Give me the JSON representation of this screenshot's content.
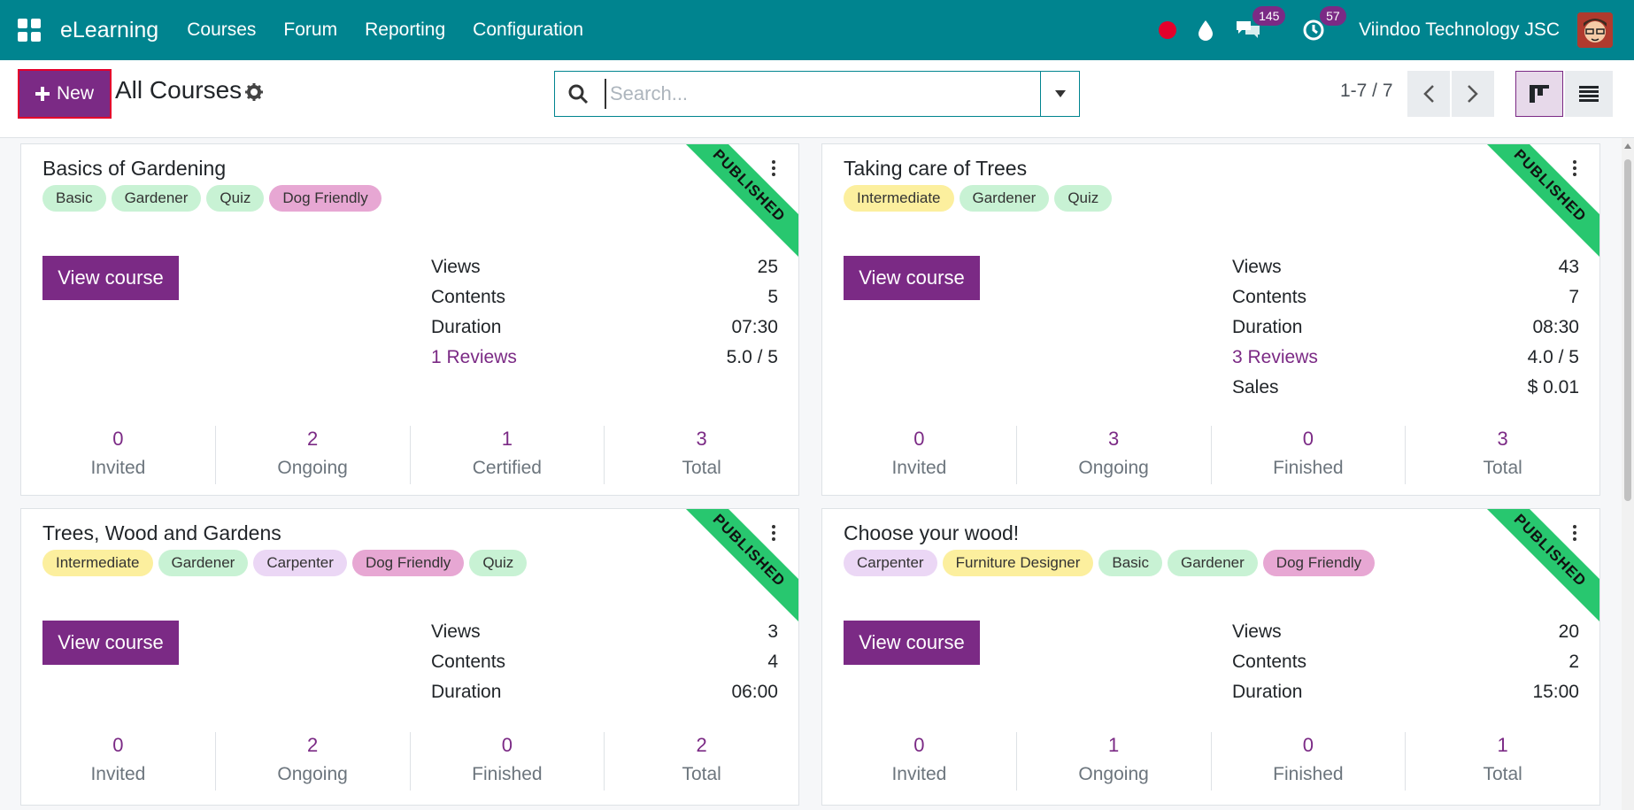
{
  "navbar": {
    "brand": "eLearning",
    "menu": [
      "Courses",
      "Forum",
      "Reporting",
      "Configuration"
    ],
    "messages_count": "145",
    "activities_count": "57",
    "company": "Viindoo Technology JSC"
  },
  "control_panel": {
    "new_label": "New",
    "title": "All Courses",
    "search_placeholder": "Search...",
    "pager": "1-7 / 7"
  },
  "colors": {
    "navbar": "#00848f",
    "primary": "#7b2a85",
    "ribbon": "#28c76f",
    "tag_green": "#c8f2d4",
    "tag_yellow": "#fcef9e",
    "tag_pink": "#e7a7d3",
    "tag_lavender": "#ebd7f5"
  },
  "cards": [
    {
      "title": "Basics of Gardening",
      "ribbon": "PUBLISHED",
      "tags": [
        "Basic",
        "Gardener",
        "Quiz",
        "Dog Friendly"
      ],
      "button": "View course",
      "stats": [
        {
          "label": "Views",
          "value": "25"
        },
        {
          "label": "Contents",
          "value": "5"
        },
        {
          "label": "Duration",
          "value": "07:30"
        },
        {
          "label": "1 Reviews",
          "value": "5.0 / 5"
        }
      ],
      "bottom": [
        {
          "num": "0",
          "label": "Invited"
        },
        {
          "num": "2",
          "label": "Ongoing"
        },
        {
          "num": "1",
          "label": "Certified"
        },
        {
          "num": "3",
          "label": "Total"
        }
      ]
    },
    {
      "title": "Taking care of Trees",
      "ribbon": "PUBLISHED",
      "tags": [
        "Intermediate",
        "Gardener",
        "Quiz"
      ],
      "button": "View course",
      "stats": [
        {
          "label": "Views",
          "value": "43"
        },
        {
          "label": "Contents",
          "value": "7"
        },
        {
          "label": "Duration",
          "value": "08:30"
        },
        {
          "label": "3 Reviews",
          "value": "4.0 / 5"
        },
        {
          "label": "Sales",
          "value": "$ 0.01"
        }
      ],
      "bottom": [
        {
          "num": "0",
          "label": "Invited"
        },
        {
          "num": "3",
          "label": "Ongoing"
        },
        {
          "num": "0",
          "label": "Finished"
        },
        {
          "num": "3",
          "label": "Total"
        }
      ]
    },
    {
      "title": "Trees, Wood and Gardens",
      "ribbon": "PUBLISHED",
      "tags": [
        "Intermediate",
        "Gardener",
        "Carpenter",
        "Dog Friendly",
        "Quiz"
      ],
      "button": "View course",
      "stats": [
        {
          "label": "Views",
          "value": "3"
        },
        {
          "label": "Contents",
          "value": "4"
        },
        {
          "label": "Duration",
          "value": "06:00"
        }
      ],
      "bottom": [
        {
          "num": "0",
          "label": "Invited"
        },
        {
          "num": "2",
          "label": "Ongoing"
        },
        {
          "num": "0",
          "label": "Finished"
        },
        {
          "num": "2",
          "label": "Total"
        }
      ]
    },
    {
      "title": "Choose your wood!",
      "ribbon": "PUBLISHED",
      "tags": [
        "Carpenter",
        "Furniture Designer",
        "Basic",
        "Gardener",
        "Dog Friendly"
      ],
      "button": "View course",
      "stats": [
        {
          "label": "Views",
          "value": "20"
        },
        {
          "label": "Contents",
          "value": "2"
        },
        {
          "label": "Duration",
          "value": "15:00"
        }
      ],
      "bottom": [
        {
          "num": "0",
          "label": "Invited"
        },
        {
          "num": "1",
          "label": "Ongoing"
        },
        {
          "num": "0",
          "label": "Finished"
        },
        {
          "num": "1",
          "label": "Total"
        }
      ]
    }
  ]
}
